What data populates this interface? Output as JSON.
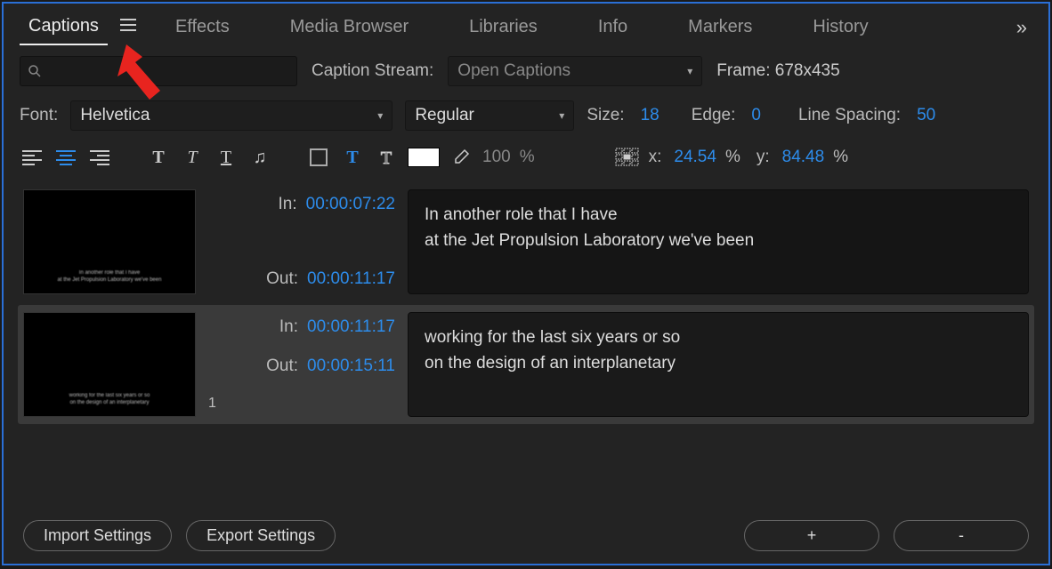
{
  "tabs": {
    "captions": "Captions",
    "effects": "Effects",
    "media_browser": "Media Browser",
    "libraries": "Libraries",
    "info": "Info",
    "markers": "Markers",
    "history": "History"
  },
  "stream": {
    "label": "Caption Stream:",
    "value": "Open Captions"
  },
  "frame": {
    "label": "Frame:",
    "value": "678x435"
  },
  "font": {
    "label": "Font:",
    "name": "Helvetica",
    "style": "Regular",
    "size_label": "Size:",
    "size": "18",
    "edge_label": "Edge:",
    "edge": "0",
    "line_spacing_label": "Line Spacing:",
    "line_spacing": "50"
  },
  "opacity": {
    "value": "100",
    "suffix": "%"
  },
  "position": {
    "x_label": "x:",
    "x": "24.54",
    "y_label": "y:",
    "y": "84.48",
    "pct": "%"
  },
  "captions": [
    {
      "in_label": "In:",
      "in": "00:00:07:22",
      "out_label": "Out:",
      "out": "00:00:11:17",
      "line1": "In another role that I have",
      "line2": "at the Jet Propulsion Laboratory we've been"
    },
    {
      "in_label": "In:",
      "in": "00:00:11:17",
      "out_label": "Out:",
      "out": "00:00:15:11",
      "line1": "working for the last six years or so",
      "line2": "on the design of an interplanetary"
    }
  ],
  "footer": {
    "import": "Import Settings",
    "export": "Export Settings",
    "add": "+",
    "remove": "-"
  }
}
